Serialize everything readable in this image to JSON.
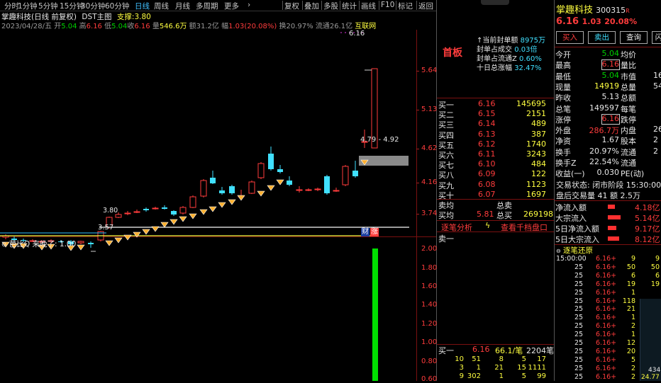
{
  "toolbar": {
    "periods": [
      "分时",
      "1分钟",
      "5分钟",
      "15分钟",
      "30分钟",
      "60分钟",
      "日线",
      "周线",
      "月线",
      "多周期",
      "更多"
    ],
    "more_arrow": "›",
    "actions": [
      "复权",
      "叠加",
      "多股",
      "统计",
      "画线",
      "F10",
      "标记",
      "返回"
    ],
    "active_period": "日线"
  },
  "chart_header": {
    "stock": "掌趣科技(日线 前复权)",
    "indicator": "DST主图",
    "support_label": "支撑:",
    "support_value": "3.80",
    "date": "2023/04/28/五",
    "open_label": "开",
    "open": "5.04",
    "high_label": "高",
    "high": "6.16",
    "low_label": "低",
    "low": "5.04",
    "close_label": "收",
    "close": "6.16",
    "vol_label": "量",
    "vol": "546.6万",
    "amount_label": "额",
    "amount": "31.2亿",
    "range_label": "幅",
    "range": "1.03(20.08%)",
    "turnover_label": "换",
    "turnover": "20.97%",
    "float_label": "流通",
    "float": "26.1亿",
    "link": "互联网"
  },
  "price_axis": [
    "5.64",
    "5.13",
    "4.62",
    "4.16",
    "3.74"
  ],
  "chart_annotations": {
    "peak_label": "6.16",
    "range_label": "4.79 - 4.92",
    "low_label": "3.57",
    "support_tag": "3.80",
    "finance_badge": "财",
    "limit_badge": "涨"
  },
  "sub_indicator": {
    "name": "芭比Q",
    "label": "来晚了:",
    "value": "1.00",
    "axis": [
      "2.00",
      "1.80",
      "1.60",
      "1.40",
      "1.20",
      "1.00",
      "0.80",
      "0.60"
    ]
  },
  "mid_panel": {
    "board": "首板",
    "stats": [
      {
        "label": "↑当前封单额",
        "value": "8975万"
      },
      {
        "label": "封单占成交",
        "value": "0.03倍"
      },
      {
        "label": "封单占流通Z",
        "value": "0.60%"
      },
      {
        "label": "十日总涨幅",
        "value": "32.47%"
      }
    ],
    "bids": [
      {
        "label": "买一",
        "price": "6.16",
        "vol": "145695"
      },
      {
        "label": "买二",
        "price": "6.15",
        "vol": "2151"
      },
      {
        "label": "买三",
        "price": "6.14",
        "vol": "489"
      },
      {
        "label": "买四",
        "price": "6.13",
        "vol": "387"
      },
      {
        "label": "买五",
        "price": "6.12",
        "vol": "1740"
      },
      {
        "label": "买六",
        "price": "6.11",
        "vol": "3243"
      },
      {
        "label": "买七",
        "price": "6.10",
        "vol": "484"
      },
      {
        "label": "买八",
        "price": "6.09",
        "vol": "122"
      },
      {
        "label": "买九",
        "price": "6.08",
        "vol": "1123"
      },
      {
        "label": "买十",
        "price": "6.07",
        "vol": "1697"
      }
    ],
    "sell_avg_label": "卖均",
    "sell_total_label": "总卖",
    "buy_avg_label": "买均",
    "buy_avg": "5.81",
    "buy_total_label": "总买",
    "buy_total": "269198",
    "links": [
      "逐笔分析",
      "查看千档盘口"
    ],
    "ask1_label": "卖一",
    "queue_head": {
      "label": "买一",
      "price": "6.16",
      "avg": "66.1/笔",
      "count": "2204笔"
    },
    "queue": [
      [
        "10",
        "51",
        "8",
        "5",
        "17"
      ],
      [
        "3",
        "1",
        "21",
        "15",
        "1111"
      ],
      [
        "9",
        "302",
        "1",
        "5",
        "99"
      ]
    ]
  },
  "quote": {
    "name": "掌趣科技",
    "code": "300315",
    "flag": "R",
    "price": "6.16",
    "change": "1.03",
    "pct": "20.08%",
    "buttons": [
      "买入",
      "卖出",
      "查询",
      "闪"
    ],
    "rows": [
      {
        "l": "今开",
        "v": "5.04",
        "l2": "均价"
      },
      {
        "l": "最高",
        "v": "6.16",
        "l2": "量比"
      },
      {
        "l": "最低",
        "v": "5.04",
        "l2": "市值",
        "v2": "16"
      },
      {
        "l": "现量",
        "v": "14919",
        "l2": "总量",
        "v2": "54"
      },
      {
        "l": "昨收",
        "v": "5.13",
        "l2": "总额"
      },
      {
        "l": "总笔",
        "v": "149597",
        "l2": "每笔"
      },
      {
        "l": "涨停",
        "v": "6.16",
        "l2": "跌停"
      },
      {
        "l": "外盘",
        "v": "286.7万",
        "l2": "内盘",
        "v2": "26"
      },
      {
        "l": "净资",
        "v": "1.67",
        "l2": "股本",
        "v2": "2"
      },
      {
        "l": "换手",
        "v": "20.97%",
        "l2": "流通",
        "v2": "2"
      },
      {
        "l": "换手Z",
        "v": "22.54%",
        "l2": "流通"
      },
      {
        "l": "收益(一)",
        "v": "0.030",
        "l2": "PE(动)"
      }
    ],
    "trade_status": "交易状态: 闭市阶段 15:30:00",
    "after_hours": "盘后交易量 41 额 2.5万",
    "flows": [
      {
        "l": "净流入额",
        "v": "4.18亿"
      },
      {
        "l": "大宗流入",
        "v": "5.14亿"
      },
      {
        "l": "5日净流入额",
        "v": "9.17亿"
      },
      {
        "l": "5日大宗流入",
        "v": "8.12亿"
      }
    ],
    "ticks_title": "逐笔还原",
    "ticks": [
      [
        "15:00:00",
        "6.16+",
        "9",
        "9"
      ],
      [
        "25",
        "6.16+",
        "50",
        "50"
      ],
      [
        "25",
        "6.16+",
        "6",
        "6"
      ],
      [
        "25",
        "6.16+",
        "19",
        "19"
      ],
      [
        "25",
        "6.16+",
        "1",
        ""
      ],
      [
        "25",
        "6.16+",
        "118",
        ""
      ],
      [
        "25",
        "6.16+",
        "21",
        ""
      ],
      [
        "25",
        "6.16+",
        "1",
        ""
      ],
      [
        "25",
        "6.16+",
        "2",
        ""
      ],
      [
        "25",
        "6.16+",
        "1",
        ""
      ],
      [
        "25",
        "6.16+",
        "12",
        ""
      ],
      [
        "25",
        "6.16+",
        "20",
        ""
      ],
      [
        "25",
        "6.16+",
        "5",
        ""
      ],
      [
        "25",
        "6.16+",
        "2",
        ""
      ],
      [
        "25",
        "6.16+",
        "2",
        ""
      ]
    ],
    "tick_tail": [
      "434",
      "24.77"
    ]
  }
}
